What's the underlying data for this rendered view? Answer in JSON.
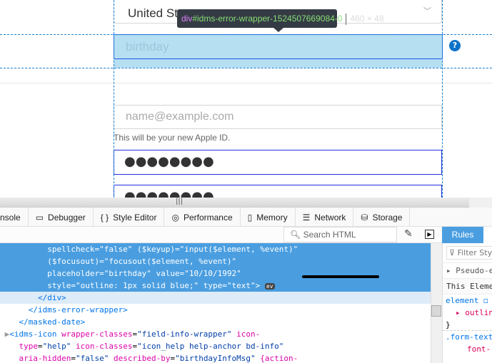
{
  "page": {
    "country_value": "United States",
    "birthday_placeholder": "birthday",
    "help_icon": "?",
    "email_placeholder": "name@example.com",
    "email_hint": "This will be your new Apple ID.",
    "password_mask": "●●●●●●●●",
    "confirm_mask": "●●●●●●●●"
  },
  "tooltip": {
    "tag": "div",
    "id": "#idms-error-wrapper-1524507669084-0",
    "size": "460 × 48"
  },
  "devtools": {
    "tabs": [
      "nsole",
      "Debugger",
      "Style Editor",
      "Performance",
      "Memory",
      "Network",
      "Storage"
    ],
    "search_placeholder": "Search HTML",
    "rules_tab": "Rules",
    "markup_lines": [
      "          spellcheck=\"false\" ($keyup)=\"input($element, %event)\"",
      "          ($focusout)=\"focusout($element, %event)\"",
      "          placeholder=\"birthday\" value=\"10/10/1992\"",
      "          style=\"outline: 1px solid blue;\" type=\"text\">",
      "        </div>",
      "      </idms-error-wrapper>",
      "    </masked-date>"
    ],
    "ev_badge": "ev",
    "idms_icon": {
      "tag": "<idms-icon",
      "attr1": "wrapper-classes",
      "val1": "\"field-info-wrapper\"",
      "attr2": "icon-",
      "attr2b": "type",
      "val2": "\"help\"",
      "attr3": "icon-classes",
      "val3": "\"icon_help help-anchor bd-info\"",
      "attr4": "aria-hidden",
      "val4": "\"false\"",
      "attr5": "described-by",
      "val5": "\"birthdayInfoMsg\"",
      "attr6": "{action-"
    },
    "rules": {
      "filter_placeholder": "Filter Styles",
      "pseudo": "Pseudo-elements",
      "this_element": "This Element",
      "element": "element",
      "prop": "outline",
      "close": "}",
      "selector": ".form-textbox",
      "prop2": "font-"
    }
  }
}
